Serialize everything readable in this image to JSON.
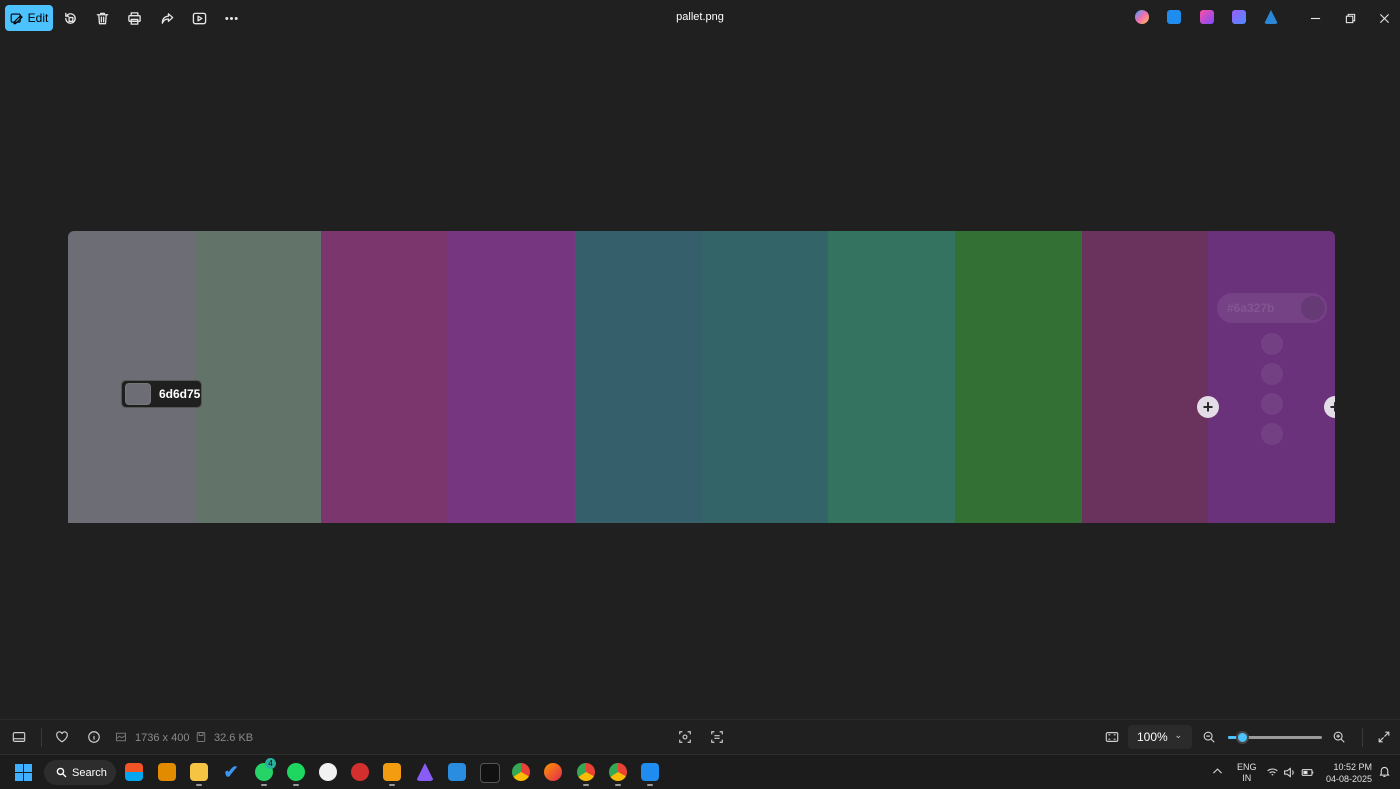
{
  "toolbar": {
    "edit_label": "Edit",
    "file_title": "pallet.png"
  },
  "palette": {
    "colors": [
      "#6d6d75",
      "#62746a",
      "#7b376d",
      "#773680",
      "#355f6a",
      "#336468",
      "#34735f",
      "#337034",
      "#69335e",
      "#6a327b"
    ],
    "tooltip_hex": "6d6d75",
    "ghost_label": "#6a327b"
  },
  "status": {
    "dimensions": "1736 x 400",
    "filesize": "32.6 KB",
    "zoom": "100%",
    "zoom_level_percent": 15
  },
  "taskbar": {
    "search_label": "Search",
    "whatsapp_badge": "4",
    "lang_line1": "ENG",
    "lang_line2": "IN",
    "time": "10:52 PM",
    "date": "04-08-2025"
  },
  "accent_color": "#4cc2ff"
}
